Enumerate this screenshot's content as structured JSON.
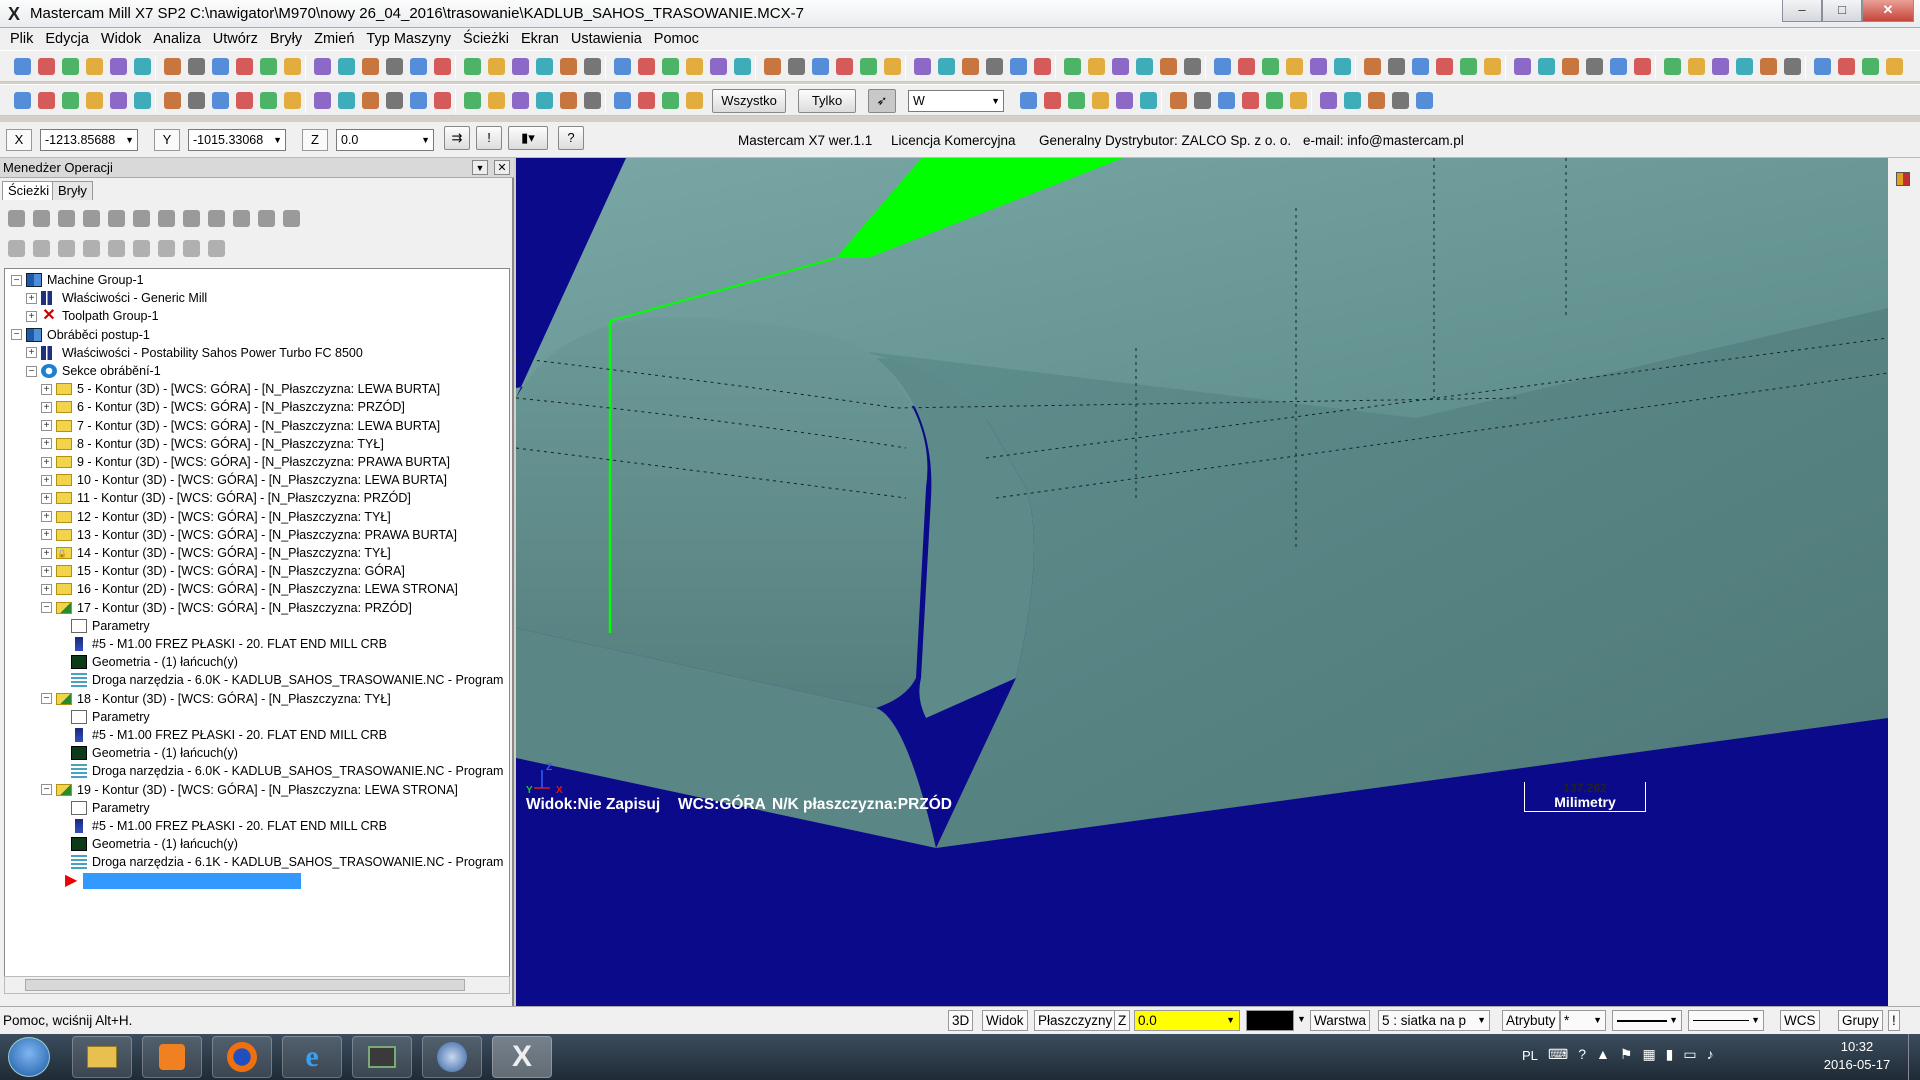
{
  "window": {
    "title": "Mastercam Mill X7 SP2  C:\\nawigator\\M970\\nowy 26_04_2016\\trasowanie\\KADLUB_SAHOS_TRASOWANIE.MCX-7",
    "minimize": "–",
    "maximize": "□",
    "close": "✕"
  },
  "menu": [
    "Plik",
    "Edycja",
    "Widok",
    "Analiza",
    "Utwórz",
    "Bryły",
    "Zmień",
    "Typ Maszyny",
    "Ścieżki",
    "Ekran",
    "Ustawienia",
    "Pomoc"
  ],
  "toolbar2": {
    "all_label": "Wszystko",
    "only_label": "Tylko",
    "filter_value": "W"
  },
  "coords": {
    "x_label": "X",
    "x_value": "-1213.85688",
    "y_label": "Y",
    "y_value": "-1015.33068",
    "z_label": "Z",
    "z_value": "0.0"
  },
  "info": {
    "version": "Mastercam X7 wer.1.1",
    "license": "Licencja Komercyjna",
    "distributor": "Generalny Dystrybutor:  ZALCO Sp. z o. o.",
    "email": "e-mail:  info@mastercam.pl"
  },
  "panel": {
    "title": "Menedżer Operacji",
    "tab_paths": "Ścieżki",
    "tab_solids": "Bryły"
  },
  "tree": [
    {
      "level": 0,
      "exp": "-",
      "icon": "machine",
      "text": "Machine Group-1"
    },
    {
      "level": 1,
      "exp": "+",
      "icon": "props",
      "text": "Właściwości - Generic Mill"
    },
    {
      "level": 1,
      "exp": "+",
      "icon": "x",
      "text": "Toolpath Group-1"
    },
    {
      "level": 0,
      "exp": "-",
      "icon": "machine",
      "text": "Obráběci postup-1"
    },
    {
      "level": 1,
      "exp": "+",
      "icon": "props",
      "text": "Właściwości - Postability Sahos Power Turbo FC 8500"
    },
    {
      "level": 1,
      "exp": "-",
      "icon": "section",
      "text": "Sekce obrábění-1"
    },
    {
      "level": 2,
      "exp": "+",
      "icon": "folder",
      "text": "5 - Kontur (3D) - [WCS: GÓRA] - [N_Płaszczyzna: LEWA BURTA]"
    },
    {
      "level": 2,
      "exp": "+",
      "icon": "folder",
      "text": "6 - Kontur (3D) - [WCS: GÓRA] - [N_Płaszczyzna: PRZÓD]"
    },
    {
      "level": 2,
      "exp": "+",
      "icon": "folder",
      "text": "7 - Kontur (3D) - [WCS: GÓRA] - [N_Płaszczyzna: LEWA BURTA]"
    },
    {
      "level": 2,
      "exp": "+",
      "icon": "folder",
      "text": "8 - Kontur (3D) - [WCS: GÓRA] - [N_Płaszczyzna: TYŁ]"
    },
    {
      "level": 2,
      "exp": "+",
      "icon": "folder",
      "text": "9 - Kontur (3D) - [WCS: GÓRA] - [N_Płaszczyzna: PRAWA BURTA]"
    },
    {
      "level": 2,
      "exp": "+",
      "icon": "folder",
      "text": "10 - Kontur (3D) - [WCS: GÓRA] - [N_Płaszczyzna: LEWA BURTA]"
    },
    {
      "level": 2,
      "exp": "+",
      "icon": "folder",
      "text": "11 - Kontur (3D) - [WCS: GÓRA] - [N_Płaszczyzna: PRZÓD]"
    },
    {
      "level": 2,
      "exp": "+",
      "icon": "folder",
      "text": "12 - Kontur (3D) - [WCS: GÓRA] - [N_Płaszczyzna: TYŁ]"
    },
    {
      "level": 2,
      "exp": "+",
      "icon": "folder",
      "text": "13 - Kontur (3D) - [WCS: GÓRA] - [N_Płaszczyzna: PRAWA BURTA]"
    },
    {
      "level": 2,
      "exp": "+",
      "icon": "lockfolder",
      "text": "14 - Kontur (3D) - [WCS: GÓRA] - [N_Płaszczyzna: TYŁ]"
    },
    {
      "level": 2,
      "exp": "+",
      "icon": "folder",
      "text": "15 - Kontur (3D) - [WCS: GÓRA] - [N_Płaszczyzna: GÓRA]"
    },
    {
      "level": 2,
      "exp": "+",
      "icon": "folder",
      "text": "16 - Kontur (2D) - [WCS: GÓRA] - [N_Płaszczyzna: LEWA STRONA]"
    },
    {
      "level": 2,
      "exp": "-",
      "icon": "opfolder",
      "text": "17 - Kontur (3D) - [WCS: GÓRA] - [N_Płaszczyzna: PRZÓD]"
    },
    {
      "level": 3,
      "exp": "",
      "icon": "params",
      "text": "Parametry"
    },
    {
      "level": 3,
      "exp": "",
      "icon": "tool",
      "text": "#5 - M1.00 FREZ PŁASKI -  20. FLAT END MILL CRB"
    },
    {
      "level": 3,
      "exp": "",
      "icon": "geom",
      "text": "Geometria - (1) łańcuch(y)"
    },
    {
      "level": 3,
      "exp": "",
      "icon": "path",
      "text": "Droga narzędzia - 6.0K - KADLUB_SAHOS_TRASOWANIE.NC - Program"
    },
    {
      "level": 2,
      "exp": "-",
      "icon": "opfolder",
      "text": "18 - Kontur (3D) - [WCS: GÓRA] - [N_Płaszczyzna: TYŁ]"
    },
    {
      "level": 3,
      "exp": "",
      "icon": "params",
      "text": "Parametry"
    },
    {
      "level": 3,
      "exp": "",
      "icon": "tool",
      "text": "#5 - M1.00 FREZ PŁASKI -  20. FLAT END MILL CRB"
    },
    {
      "level": 3,
      "exp": "",
      "icon": "geom",
      "text": "Geometria - (1) łańcuch(y)"
    },
    {
      "level": 3,
      "exp": "",
      "icon": "path",
      "text": "Droga narzędzia - 6.0K - KADLUB_SAHOS_TRASOWANIE.NC - Program"
    },
    {
      "level": 2,
      "exp": "-",
      "icon": "opfolder",
      "text": "19 - Kontur (3D) - [WCS: GÓRA] - [N_Płaszczyzna: LEWA STRONA]"
    },
    {
      "level": 3,
      "exp": "",
      "icon": "params",
      "text": "Parametry"
    },
    {
      "level": 3,
      "exp": "",
      "icon": "tool",
      "text": "#5 - M1.00 FREZ PŁASKI -  20. FLAT END MILL CRB"
    },
    {
      "level": 3,
      "exp": "",
      "icon": "geom",
      "text": "Geometria - (1) łańcuch(y)"
    },
    {
      "level": 3,
      "exp": "",
      "icon": "path",
      "text": "Droga narzędzia - 6.1K - KADLUB_SAHOS_TRASOWANIE.NC - Program"
    }
  ],
  "viewport": {
    "view": "Widok:Nie Zapisuj",
    "wcs": "WCS:GÓRA",
    "plane": "N/K płaszczyzna:PRZÓD",
    "scale_value": "137.262",
    "units": "Milimetry",
    "bg_color": "#0a0a8a",
    "model_color": "#5f8f8e",
    "highlight_color": "#00ff00"
  },
  "status": {
    "help": "Pomoc, wciśnij Alt+H.",
    "btn_3d": "3D",
    "btn_view": "Widok",
    "btn_planes": "Płaszczyzny",
    "z_label": "Z",
    "z_value": "0.0",
    "layer_label": "Warstwa",
    "layer_value": "5 : siatka na p",
    "attrs": "Atrybuty",
    "wcs": "WCS",
    "groups": "Grupy"
  },
  "taskbar": {
    "lang": "PL",
    "time": "10:32",
    "date": "2016-05-17"
  }
}
